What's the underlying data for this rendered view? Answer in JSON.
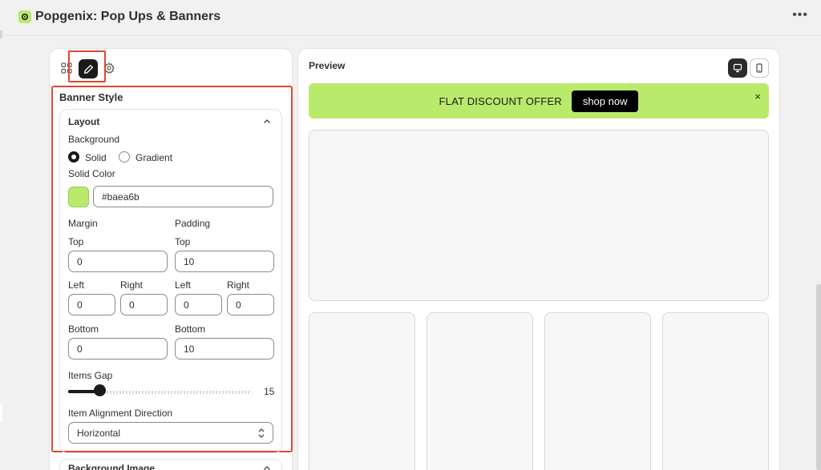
{
  "app": {
    "title": "Popgenix: Pop Ups & Banners",
    "menu_icon": "more-horizontal-icon"
  },
  "editor": {
    "tabs": [
      "grid-icon",
      "pencil-icon",
      "gear-icon"
    ],
    "active_tab": "pencil-icon",
    "section_title": "Banner Style",
    "layout": {
      "title": "Layout",
      "background_label": "Background",
      "bg_options": [
        "Solid",
        "Gradient"
      ],
      "bg_selected": "Solid",
      "solid_color_label": "Solid Color",
      "solid_color_value": "#baea6b",
      "margin_label": "Margin",
      "padding_label": "Padding",
      "top_label": "Top",
      "left_label": "Left",
      "right_label": "Right",
      "bottom_label": "Bottom",
      "margin": {
        "top": "0",
        "left": "0",
        "right": "0",
        "bottom": "0"
      },
      "padding": {
        "top": "10",
        "left": "0",
        "right": "0",
        "bottom": "10"
      },
      "items_gap_label": "Items Gap",
      "items_gap_value": "15",
      "items_gap_fraction": 0.17,
      "alignment_label": "Item Alignment Direction",
      "alignment_value": "Horizontal"
    },
    "background_image": {
      "title": "Background Image"
    }
  },
  "preview": {
    "title": "Preview",
    "devices": [
      "desktop-icon",
      "mobile-icon"
    ],
    "active_device": "desktop-icon",
    "banner": {
      "text": "FLAT DISCOUNT OFFER",
      "button_label": "shop now",
      "close_label": "×",
      "background_color": "#baea6b"
    }
  },
  "colors": {
    "accent": "#baea6b",
    "highlight": "#e0482f",
    "dark": "#1a1a1a"
  }
}
